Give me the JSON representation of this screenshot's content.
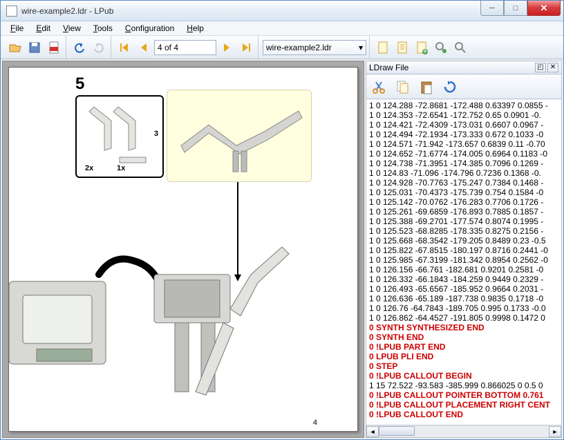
{
  "window": {
    "title": "wire-example2.ldr - LPub"
  },
  "menu": {
    "file": "File",
    "edit": "Edit",
    "view": "View",
    "tools": "Tools",
    "config": "Configuration",
    "help": "Help"
  },
  "toolbar": {
    "page_field": "4 of 4",
    "file_select": "wire-example2.ldr"
  },
  "page": {
    "step": "5",
    "callout_qty1": "2x",
    "callout_qty2": "1x",
    "callout_label": "3",
    "page_number": "4"
  },
  "panel": {
    "title": "LDraw File"
  },
  "code_lines": [
    {
      "t": "1 0 124.288 -72.8681 -172.488 0.63397 0.0855 -"
    },
    {
      "t": "1 0 124.353 -72.6541 -172.752 0.65 0.0901 -0."
    },
    {
      "t": "1 0 124.421 -72.4309 -173.031 0.6607 0.0967 -"
    },
    {
      "t": "1 0 124.494 -72.1934 -173.333 0.672 0.1033 -0"
    },
    {
      "t": "1 0 124.571 -71.942 -173.657 0.6839 0.11 -0.70"
    },
    {
      "t": "1 0 124.652 -71.6774 -174.005 0.6964 0.1183 -0"
    },
    {
      "t": "1 0 124.738 -71.3951 -174.385 0.7096 0.1269 -"
    },
    {
      "t": "1 0 124.83 -71.096 -174.796 0.7236 0.1368 -0."
    },
    {
      "t": "1 0 124.928 -70.7763 -175.247 0.7384 0.1468 -"
    },
    {
      "t": "1 0 125.031 -70.4373 -175.739 0.754 0.1584 -0"
    },
    {
      "t": "1 0 125.142 -70.0762 -176.283 0.7706 0.1726 -"
    },
    {
      "t": "1 0 125.261 -69.6859 -176.893 0.7885 0.1857 -"
    },
    {
      "t": "1 0 125.388 -69.2701 -177.574 0.8074 0.1995 -"
    },
    {
      "t": "1 0 125.523 -68.8285 -178.335 0.8275 0.2156 -"
    },
    {
      "t": "1 0 125.668 -68.3542 -179.205 0.8489 0.23 -0.5"
    },
    {
      "t": "1 0 125.822 -67.8515 -180.197 0.8716 0.2441 -0"
    },
    {
      "t": "1 0 125.985 -67.3199 -181.342 0.8954 0.2562 -0"
    },
    {
      "t": "1 0 126.156 -66.761 -182.681 0.9201 0.2581 -0"
    },
    {
      "t": "1 0 126.332 -66.1843 -184.259 0.9449 0.2329 -"
    },
    {
      "t": "1 0 126.493 -65.6567 -185.952 0.9664 0.2031 -"
    },
    {
      "t": "1 0 126.636 -65.189 -187.738 0.9835 0.1718 -0"
    },
    {
      "t": "1 0 126.76 -64.7843 -189.705 0.995 0.1733 -0.0"
    },
    {
      "t": "1 0 126.862 -64.4527 -191.805 0.9998 0.1472 0"
    },
    {
      "t": "0 SYNTH SYNTHESIZED END",
      "kw": true
    },
    {
      "t": "0 SYNTH END",
      "kw": true
    },
    {
      "t": "0 !LPUB PART END",
      "kw": true
    },
    {
      "t": "0 LPUB PLI END",
      "kw": true
    },
    {
      "t": "0 STEP",
      "kw": true
    },
    {
      "t": "0 !LPUB CALLOUT BEGIN",
      "kw": true
    },
    {
      "t": "1 15 72.522 -93.583 -385.999 0.866025 0 0.5 0"
    },
    {
      "t": "0 !LPUB CALLOUT POINTER BOTTOM 0.761 ",
      "kw": true
    },
    {
      "t": "0 !LPUB CALLOUT PLACEMENT RIGHT CENT",
      "kw": true
    },
    {
      "t": "0 !LPUB CALLOUT END",
      "kw": true
    }
  ]
}
